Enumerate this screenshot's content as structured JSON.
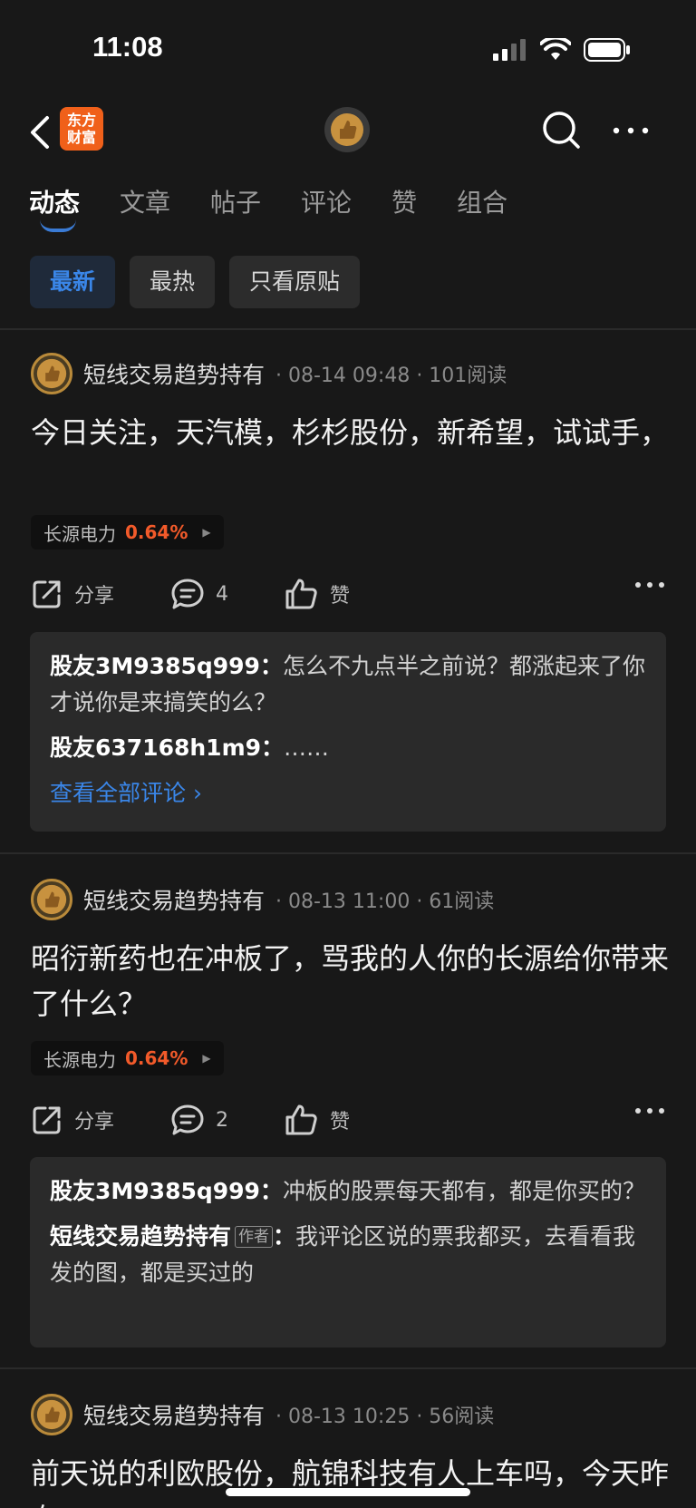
{
  "status": {
    "time": "11:08"
  },
  "nav": {
    "brand_line1": "东方",
    "brand_line2": "财富"
  },
  "tabs": [
    {
      "label": "动态",
      "active": true
    },
    {
      "label": "文章"
    },
    {
      "label": "帖子"
    },
    {
      "label": "评论"
    },
    {
      "label": "赞"
    },
    {
      "label": "组合"
    }
  ],
  "filters": [
    {
      "label": "最新",
      "active": true
    },
    {
      "label": "最热"
    },
    {
      "label": "只看原贴"
    }
  ],
  "posts": [
    {
      "author": "短线交易趋势持有",
      "meta": "· 08-14 09:48 · 101阅读",
      "body": "今日关注，天汽模，杉杉股份，新希望，试试手，",
      "stock_name": "长源电力",
      "stock_pct": "0.64%",
      "share_label": "分享",
      "comment_count": "4",
      "like_label": "赞",
      "comments": [
        {
          "name": "股友3M9385q999：",
          "text": "怎么不九点半之前说？都涨起来了你才说你是来搞笑的么？"
        },
        {
          "name": "股友637168h1m9：",
          "text": "……"
        }
      ],
      "view_all": "查看全部评论 ›"
    },
    {
      "author": "短线交易趋势持有",
      "meta": "· 08-13 11:00 · 61阅读",
      "body": "昭衍新药也在冲板了，骂我的人你的长源给你带来了什么？",
      "stock_name": "长源电力",
      "stock_pct": "0.64%",
      "share_label": "分享",
      "comment_count": "2",
      "like_label": "赞",
      "comments": [
        {
          "name": "股友3M9385q999：",
          "text": "冲板的股票每天都有，都是你买的？"
        },
        {
          "name": "短线交易趋势持有",
          "badge": "作者",
          "sep": "：",
          "text": "我评论区说的票我都买，去看看我发的图，都是买过的"
        }
      ]
    },
    {
      "author": "短线交易趋势持有",
      "meta": "· 08-13 10:25 · 56阅读",
      "body": "前天说的利欧股份，航锦科技有人上车吗，今天昨有"
    }
  ]
}
